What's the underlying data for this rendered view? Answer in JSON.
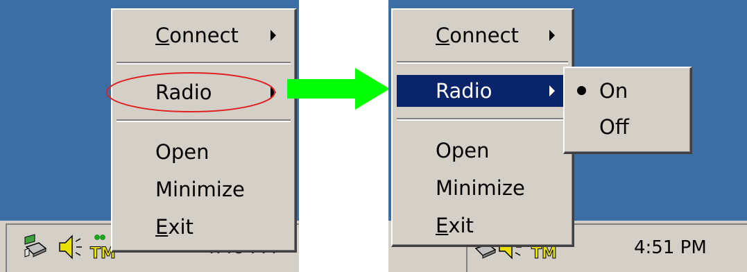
{
  "left_screenshot": {
    "clock": "4:48 PM",
    "menu": {
      "connect": {
        "prefix": "",
        "mnemonic": "C",
        "rest": "onnect"
      },
      "radio": {
        "label": "Radio"
      },
      "open": {
        "label": "Open"
      },
      "minimize": {
        "label": "Minimize"
      },
      "exit": {
        "prefix": "",
        "mnemonic": "E",
        "rest": "xit"
      }
    },
    "highlight_color": "#e02020"
  },
  "right_screenshot": {
    "clock": "4:51 PM",
    "menu": {
      "connect": {
        "prefix": "",
        "mnemonic": "C",
        "rest": "onnect"
      },
      "radio": {
        "label": "Radio"
      },
      "open": {
        "label": "Open"
      },
      "minimize": {
        "label": "Minimize"
      },
      "exit": {
        "prefix": "",
        "mnemonic": "E",
        "rest": "xit"
      }
    },
    "submenu": {
      "on": {
        "label": "On",
        "selected": true
      },
      "off": {
        "label": "Off",
        "selected": false
      }
    }
  },
  "arrow_color": "#00ff00",
  "desktop_color": "#3a6ea5",
  "menu_highlight_color": "#0a246a",
  "tray_icons": [
    "network-icon",
    "speaker-icon",
    "tm-icon"
  ]
}
